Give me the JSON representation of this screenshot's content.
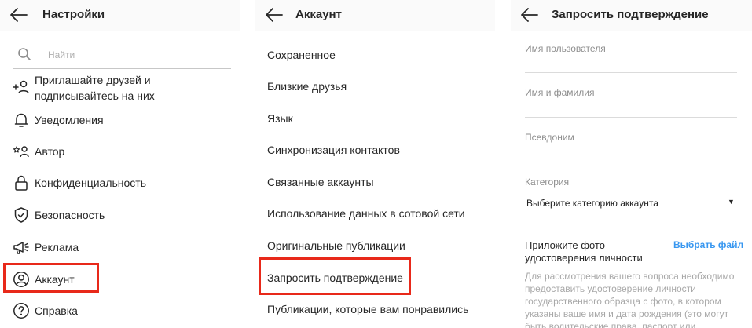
{
  "colors": {
    "highlight": "#e8291a",
    "link": "#3897f0",
    "header_bg": "#fafafa",
    "muted_text": "#8e8e8e"
  },
  "settings": {
    "title": "Настройки",
    "search_placeholder": "Найти",
    "items": [
      {
        "label": "Приглашайте друзей и подписывайтесь на них",
        "icon": "add-person-icon"
      },
      {
        "label": "Уведомления",
        "icon": "bell-icon"
      },
      {
        "label": "Автор",
        "icon": "creator-star-person-icon"
      },
      {
        "label": "Конфиденциальность",
        "icon": "lock-icon"
      },
      {
        "label": "Безопасность",
        "icon": "shield-icon"
      },
      {
        "label": "Реклама",
        "icon": "megaphone-icon"
      },
      {
        "label": "Аккаунт",
        "icon": "user-circle-icon"
      },
      {
        "label": "Справка",
        "icon": "help-circle-icon"
      }
    ]
  },
  "account": {
    "title": "Аккаунт",
    "items": [
      "Сохраненное",
      "Близкие друзья",
      "Язык",
      "Синхронизация контактов",
      "Связанные аккаунты",
      "Использование данных в сотовой сети",
      "Оригинальные публикации",
      "Запросить подтверждение",
      "Публикации, которые вам понравились"
    ]
  },
  "verification": {
    "title": "Запросить подтверждение",
    "fields": {
      "username_label": "Имя пользователя",
      "fullname_label": "Имя и фамилия",
      "nickname_label": "Псевдоним",
      "category_label": "Категория",
      "category_value": "Выберите категорию аккаунта",
      "category_arrow": "▼"
    },
    "attach_title": "Приложите фото удостоверения личности",
    "choose_file": "Выбрать файл",
    "description": "Для рассмотрения вашего вопроса необходимо предоставить удостоверение личности государственного образца с фото, в котором указаны ваше имя и дата рождения (это могут быть водительские права, паспорт или"
  }
}
